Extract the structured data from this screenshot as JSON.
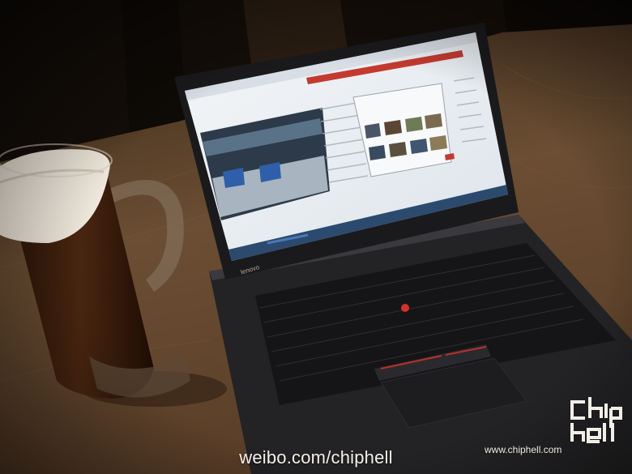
{
  "photo": {
    "watermark_url": "weibo.com/chiphell",
    "site_url": "www.chiphell.com",
    "logo_text": "chip hell",
    "laptop_brand": "lenovo"
  },
  "colors": {
    "wood": "#6b4e33",
    "beer": "#3a1e0c",
    "foam": "#f2ece2",
    "laptop": "#1e1e20",
    "screen": "#eef2f6",
    "accent_red": "#c23a30"
  }
}
